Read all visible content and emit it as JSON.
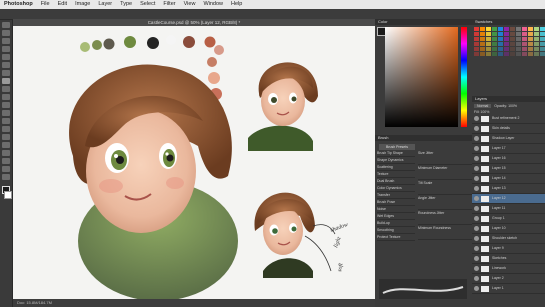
{
  "menubar": {
    "app": "Photoshop",
    "items": [
      "File",
      "Edit",
      "Image",
      "Layer",
      "Type",
      "Select",
      "Filter",
      "View",
      "Window",
      "Help"
    ]
  },
  "document": {
    "tab_title": "CastleCourse.psd @ 50% (Layer 12, RGB/8) *",
    "status": "Doc: 15.8M/184.7M"
  },
  "palette_colors": [
    "#a8bc76",
    "#7c8d4e",
    "#5e5a4e",
    "#6e8a3f",
    "#242424",
    "#f5f5f5",
    "#8a4c3b",
    "#b85f45",
    "#d79a8a",
    "#c67e65",
    "#e8a78c",
    "#c8705a",
    "#dfb09a"
  ],
  "color_panel": {
    "label": "Color",
    "swatches_label": "Swatches"
  },
  "brush_panel": {
    "tab": "Brush",
    "presets_button": "Brush Presets",
    "options": [
      "Brush Tip Shape",
      "Shape Dynamics",
      "Scattering",
      "Texture",
      "Dual Brush",
      "Color Dynamics",
      "Transfer",
      "Brush Pose",
      "Noise",
      "Wet Edges",
      "Build-up",
      "Smoothing",
      "Protect Texture"
    ],
    "settings": [
      "Size Jitter",
      "Minimum Diameter",
      "Tilt Scale",
      "Angle Jitter",
      "Roundness Jitter",
      "Minimum Roundness"
    ]
  },
  "layers_panel": {
    "tab": "Layers",
    "mode": "Normal",
    "opacity_label": "Opacity: 100%",
    "fill_label": "Fill: 100%",
    "layers": [
      "Bust refinement 2",
      "Skin details",
      "Shadow Layer",
      "Layer 17",
      "Layer 16",
      "Layer 15",
      "Layer 14",
      "Layer 13",
      "Layer 12",
      "Layer 11",
      "Group 1",
      "Layer 10",
      "Shoulder sketch",
      "Layer 9",
      "Sketches",
      "Linework",
      "Layer 2",
      "Layer 1"
    ]
  },
  "annotations": [
    "shadow",
    "light",
    "soft"
  ]
}
